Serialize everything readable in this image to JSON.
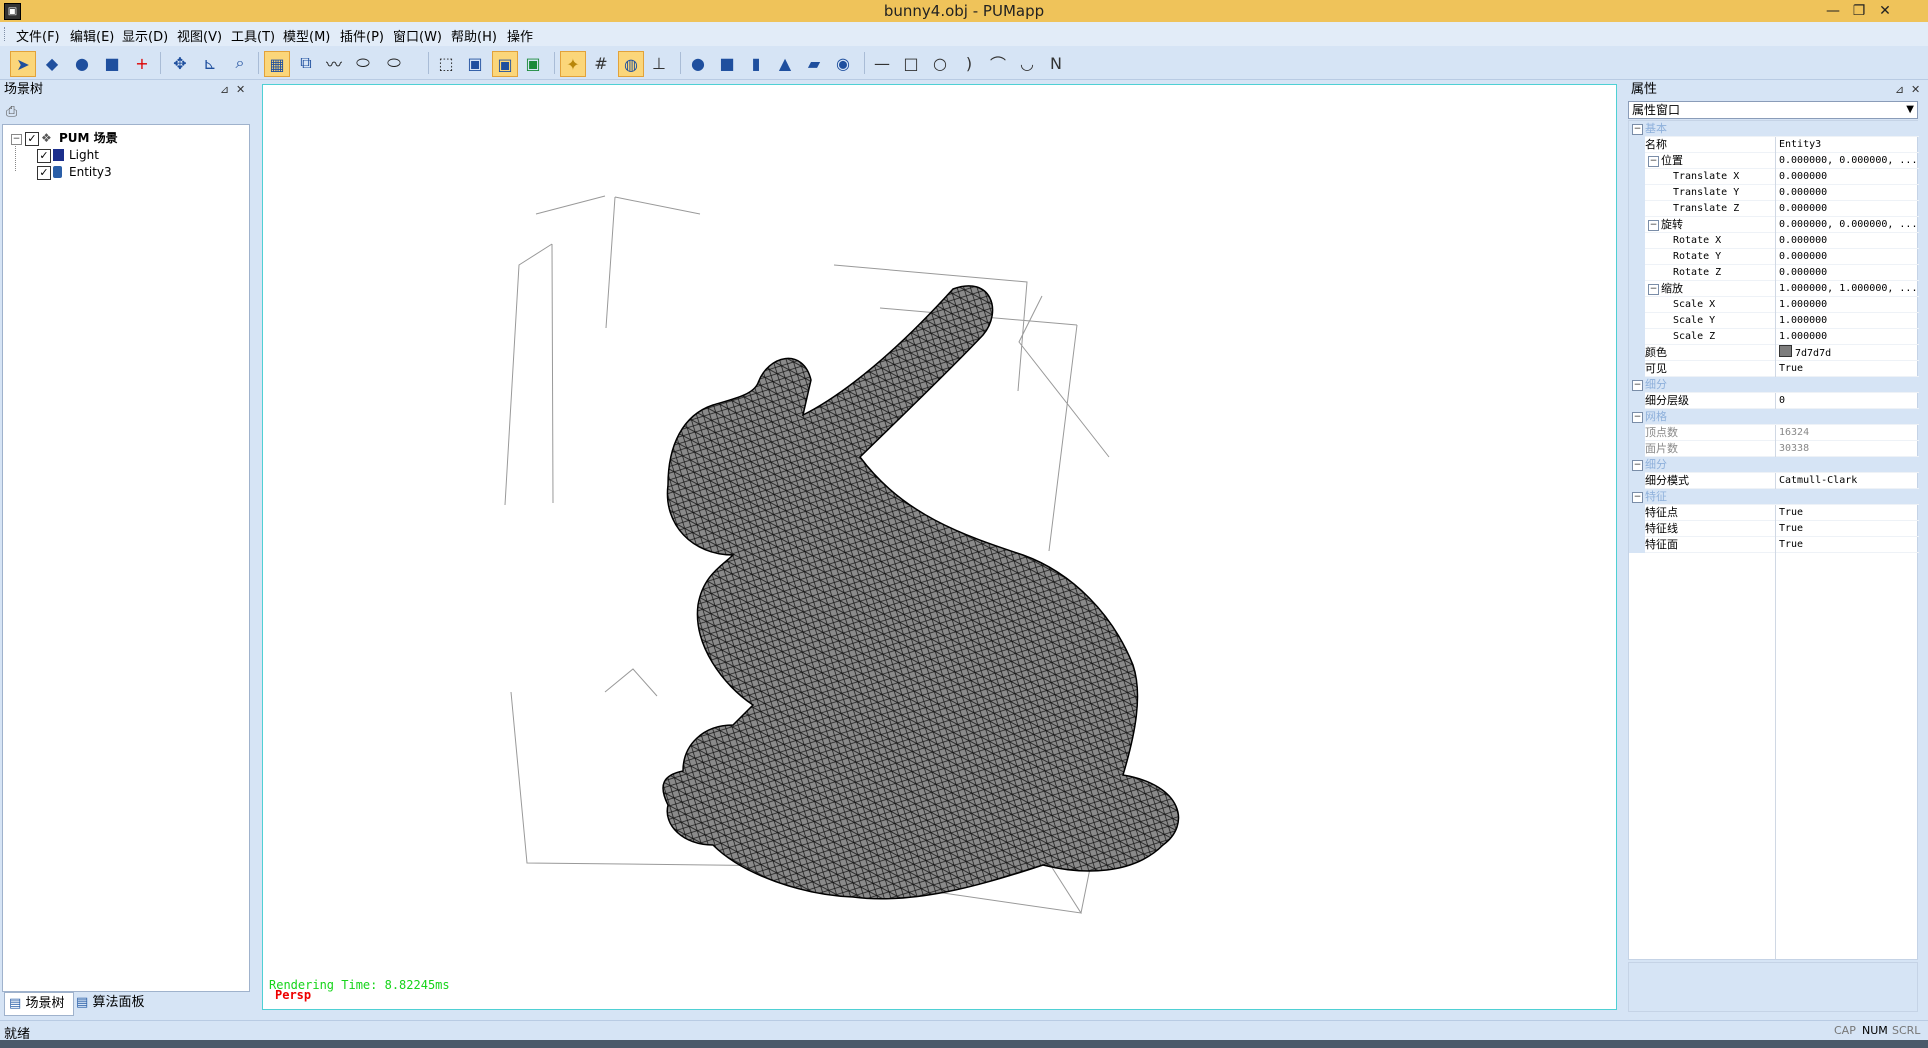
{
  "window": {
    "title": "bunny4.obj - PUMapp"
  },
  "menu": [
    "文件(F)",
    "编辑(E)",
    "显示(D)",
    "视图(V)",
    "工具(T)",
    "模型(M)",
    "插件(P)",
    "窗口(W)",
    "帮助(H)",
    "操作"
  ],
  "toolbar": {
    "icons": [
      "select-arrow-icon",
      "shade-icon",
      "paint-icon",
      "layer-icon",
      "crosshair-icon",
      "move-icon",
      "axis-icon",
      "zoom-icon",
      "grid-select-icon",
      "box-select-icon",
      "brush-icon",
      "ellipse-icon",
      "ellipse-dropdown-icon",
      "wireframe-cube-icon",
      "solid-cube-icon",
      "shaded-cube-icon",
      "color-cube-icon",
      "light-icon",
      "grid-icon",
      "mesh-view-icon",
      "transform-icon",
      "sphere-icon",
      "box-icon",
      "cylinder-icon",
      "cone-icon",
      "plane-icon",
      "torus-icon",
      "line-icon",
      "rectangle-icon",
      "circle-icon",
      "arc-icon",
      "curve-icon",
      "bezier-icon",
      "polyline-icon"
    ]
  },
  "scene_panel": {
    "title": "场景树",
    "root": "PUM 场景",
    "items": [
      "Light",
      "Entity3"
    ],
    "tabs": [
      "场景树",
      "算法面板"
    ]
  },
  "viewport": {
    "render_time": "Rendering Time: 8.82245ms",
    "view_mode": "Persp"
  },
  "properties": {
    "title": "属性",
    "selector": "属性窗口",
    "rows": [
      {
        "name": "基本",
        "value": "",
        "type": "cat"
      },
      {
        "name": "名称",
        "value": "Entity3",
        "type": "prop"
      },
      {
        "name": "位置",
        "value": "0.000000, 0.000000, ...",
        "type": "group"
      },
      {
        "name": "Translate X",
        "value": "0.000000",
        "type": "sub"
      },
      {
        "name": "Translate Y",
        "value": "0.000000",
        "type": "sub"
      },
      {
        "name": "Translate Z",
        "value": "0.000000",
        "type": "sub"
      },
      {
        "name": "旋转",
        "value": "0.000000, 0.000000, ...",
        "type": "group"
      },
      {
        "name": "Rotate X",
        "value": "0.000000",
        "type": "sub"
      },
      {
        "name": "Rotate Y",
        "value": "0.000000",
        "type": "sub"
      },
      {
        "name": "Rotate Z",
        "value": "0.000000",
        "type": "sub"
      },
      {
        "name": "缩放",
        "value": "1.000000, 1.000000, ...",
        "type": "group"
      },
      {
        "name": "Scale X",
        "value": "1.000000",
        "type": "sub"
      },
      {
        "name": "Scale Y",
        "value": "1.000000",
        "type": "sub"
      },
      {
        "name": "Scale Z",
        "value": "1.000000",
        "type": "sub"
      },
      {
        "name": "颜色",
        "value": "7d7d7d",
        "type": "color"
      },
      {
        "name": "可见",
        "value": "True",
        "type": "prop"
      },
      {
        "name": "细分",
        "value": "",
        "type": "cat"
      },
      {
        "name": "细分层级",
        "value": "0",
        "type": "prop"
      },
      {
        "name": "网格",
        "value": "",
        "type": "cat"
      },
      {
        "name": "顶点数",
        "value": "16324",
        "type": "ro"
      },
      {
        "name": "面片数",
        "value": "30338",
        "type": "ro"
      },
      {
        "name": "细分",
        "value": "",
        "type": "cat"
      },
      {
        "name": "细分模式",
        "value": "Catmull-Clark",
        "type": "prop"
      },
      {
        "name": "特征",
        "value": "",
        "type": "cat"
      },
      {
        "name": "特征点",
        "value": "True",
        "type": "prop"
      },
      {
        "name": "特征线",
        "value": "True",
        "type": "prop"
      },
      {
        "name": "特征面",
        "value": "True",
        "type": "prop"
      }
    ]
  },
  "status": {
    "text": "就绪",
    "indicators": [
      "CAP",
      "NUM",
      "SCRL"
    ],
    "active_indicator": "NUM"
  },
  "colors": {
    "accent": "#efc35a",
    "panel": "#d6e4f5",
    "viewport_border": "#4fd0d4",
    "mesh_color": "#7d7d7d"
  }
}
